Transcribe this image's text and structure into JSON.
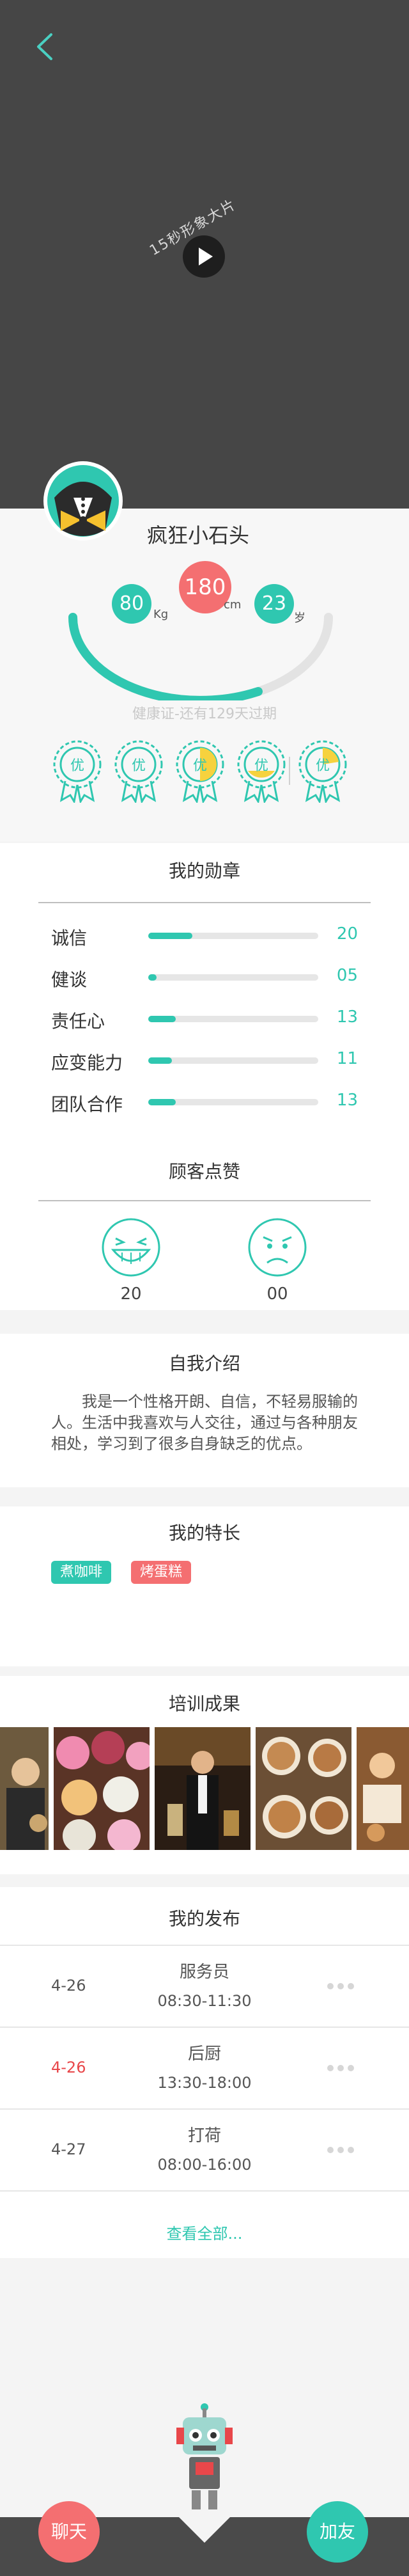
{
  "hero": {
    "video_label": "15秒形象大片"
  },
  "profile": {
    "name": "疯狂小石头",
    "weight": "80",
    "weight_unit": "Kg",
    "height": "180",
    "height_unit": "cm",
    "age": "23",
    "age_unit": "岁",
    "health": "健康证-还有129天过期",
    "medal_labels": [
      "优",
      "优",
      "优",
      "优",
      "优"
    ]
  },
  "medals": {
    "title": "我的勋章",
    "items": [
      {
        "label": "诚信",
        "value": "20",
        "fill": 0.26
      },
      {
        "label": "健谈",
        "value": "05",
        "fill": 0.05
      },
      {
        "label": "责任心",
        "value": "13",
        "fill": 0.16
      },
      {
        "label": "应变能力",
        "value": "11",
        "fill": 0.14
      },
      {
        "label": "团队合作",
        "value": "13",
        "fill": 0.16
      }
    ]
  },
  "praise": {
    "title": "顾客点赞",
    "happy_count": "20",
    "sad_count": "00"
  },
  "intro": {
    "title": "自我介绍",
    "text": "我是一个性格开朗、自信，不轻易服输的人。生活中我喜欢与人交往，通过与各种朋友相处，学习到了很多自身缺乏的优点。"
  },
  "skills": {
    "title": "我的特长",
    "tags": [
      "煮咖啡",
      "烤蛋糕"
    ]
  },
  "training": {
    "title": "培训成果"
  },
  "posts": {
    "title": "我的发布",
    "rows": [
      {
        "date": "4-26",
        "title": "服务员",
        "time": "08:30-11:30",
        "date_color": "#555555"
      },
      {
        "date": "4-26",
        "title": "后厨",
        "time": "13:30-18:00",
        "date_color": "#e8474a"
      },
      {
        "date": "4-27",
        "title": "打荷",
        "time": "08:00-16:00",
        "date_color": "#555555"
      }
    ],
    "view_all": "查看全部..."
  },
  "footer": {
    "chat": "聊天",
    "add": "加友"
  },
  "colors": {
    "accent": "#2fc7b0",
    "pink": "#f46f71",
    "hero_bg": "#464646"
  }
}
